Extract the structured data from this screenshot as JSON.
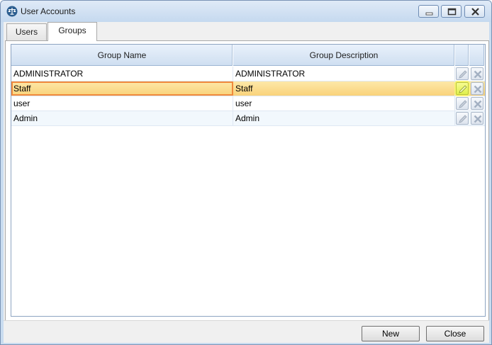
{
  "window": {
    "title": "User Accounts"
  },
  "tabs": [
    {
      "label": "Users",
      "active": false
    },
    {
      "label": "Groups",
      "active": true
    }
  ],
  "grid": {
    "columns": [
      "Group Name",
      "Group Description"
    ],
    "rows": [
      {
        "name": "ADMINISTRATOR",
        "description": "ADMINISTRATOR",
        "selected": false
      },
      {
        "name": "Staff",
        "description": "Staff",
        "selected": true
      },
      {
        "name": "user",
        "description": "user",
        "selected": false
      },
      {
        "name": "Admin",
        "description": "Admin",
        "selected": false
      }
    ],
    "row_actions": [
      "edit-icon",
      "delete-icon"
    ]
  },
  "footer": {
    "new_label": "New",
    "close_label": "Close"
  },
  "colors": {
    "titlebar": "#c5d9ef",
    "selected_row": "#f9d27a",
    "selected_border": "#f0893c",
    "edit_highlight": "#dff04b"
  }
}
